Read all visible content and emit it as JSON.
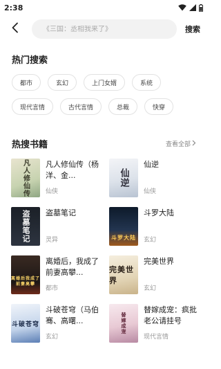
{
  "status_bar": {
    "time": "2:38",
    "icons": [
      "wifi-icon",
      "signal-icon",
      "battery-icon"
    ]
  },
  "search": {
    "back_icon": "back-arrow-icon",
    "placeholder": "《三国：丞相我来了》",
    "value": "",
    "button_label": "搜索"
  },
  "hot_search": {
    "title": "热门搜索",
    "tags": [
      "都市",
      "玄幻",
      "上门女婿",
      "系统",
      "现代言情",
      "古代言情",
      "总裁",
      "快穿"
    ]
  },
  "hot_books": {
    "title": "热搜书籍",
    "see_all_label": "查看全部",
    "see_all_icon": "chevron-right-icon",
    "books": [
      {
        "title": "凡人修仙传（杨洋、金...",
        "genre": "仙侠",
        "cover_text": "凡人修仙传"
      },
      {
        "title": "仙逆",
        "genre": "仙侠",
        "cover_text": "仙逆"
      },
      {
        "title": "盗墓笔记",
        "genre": "灵异",
        "cover_text": "盗墓笔记"
      },
      {
        "title": "斗罗大陆",
        "genre": "玄幻",
        "cover_text": "斗罗大陆"
      },
      {
        "title": "离婚后，我成了前妻高攀...",
        "genre": "都市",
        "cover_text": "离婚后我成了前妻高攀"
      },
      {
        "title": "完美世界",
        "genre": "玄幻",
        "cover_text": "完美世界"
      },
      {
        "title": "斗破苍穹（马伯骞、高曙...",
        "genre": "玄幻",
        "cover_text": "斗破苍穹"
      },
      {
        "title": "替嫁成宠：疯批老公请挂号",
        "genre": "现代言情",
        "cover_text": "替嫁成宠"
      }
    ]
  }
}
